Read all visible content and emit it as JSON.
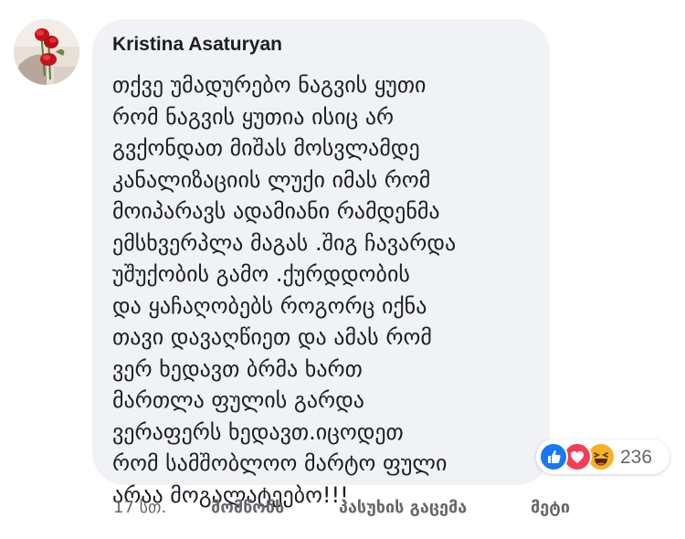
{
  "comment": {
    "author": "Kristina Asaturyan",
    "lines": [
      "თქვე უმადურებო ნაგვის ყუთი",
      "რომ ნაგვის ყუთია ისიც არ",
      "გვქონდათ მიშას მოსვლამდე",
      "კანალიზაციის ლუქი იმას რომ",
      "მოიპარავს ადამიანი რამდენმა",
      "ემსხვერპლა მაგას .შიგ ჩავარდა",
      "უშუქობის გამო .ქურდდობის",
      "და ყაჩაღობებს როგორც იქნა",
      "თავი დავაღწიეთ და ამას რომ",
      "ვერ ხედავთ ბრმა ხართ",
      "მართლა ფულის გარდა",
      "ვერაფერს ხედავთ.იცოდეთ",
      "რომ სამშობლოო მარტო ფული",
      "არაა მოგალატეებო!!!"
    ]
  },
  "reactions": {
    "icons": [
      "like-icon",
      "love-icon",
      "haha-icon"
    ],
    "count": "236"
  },
  "actions": {
    "time": "17 სთ.",
    "like": "მომწონს",
    "reply": "პასუხის გაცემა",
    "more": "მეტი"
  },
  "colors": {
    "bubble": "#f0f2f5",
    "text": "#1c1e21",
    "secondary": "#65676b",
    "like": "#1877f2",
    "love": "#f33e58",
    "haha": "#f7b125"
  }
}
